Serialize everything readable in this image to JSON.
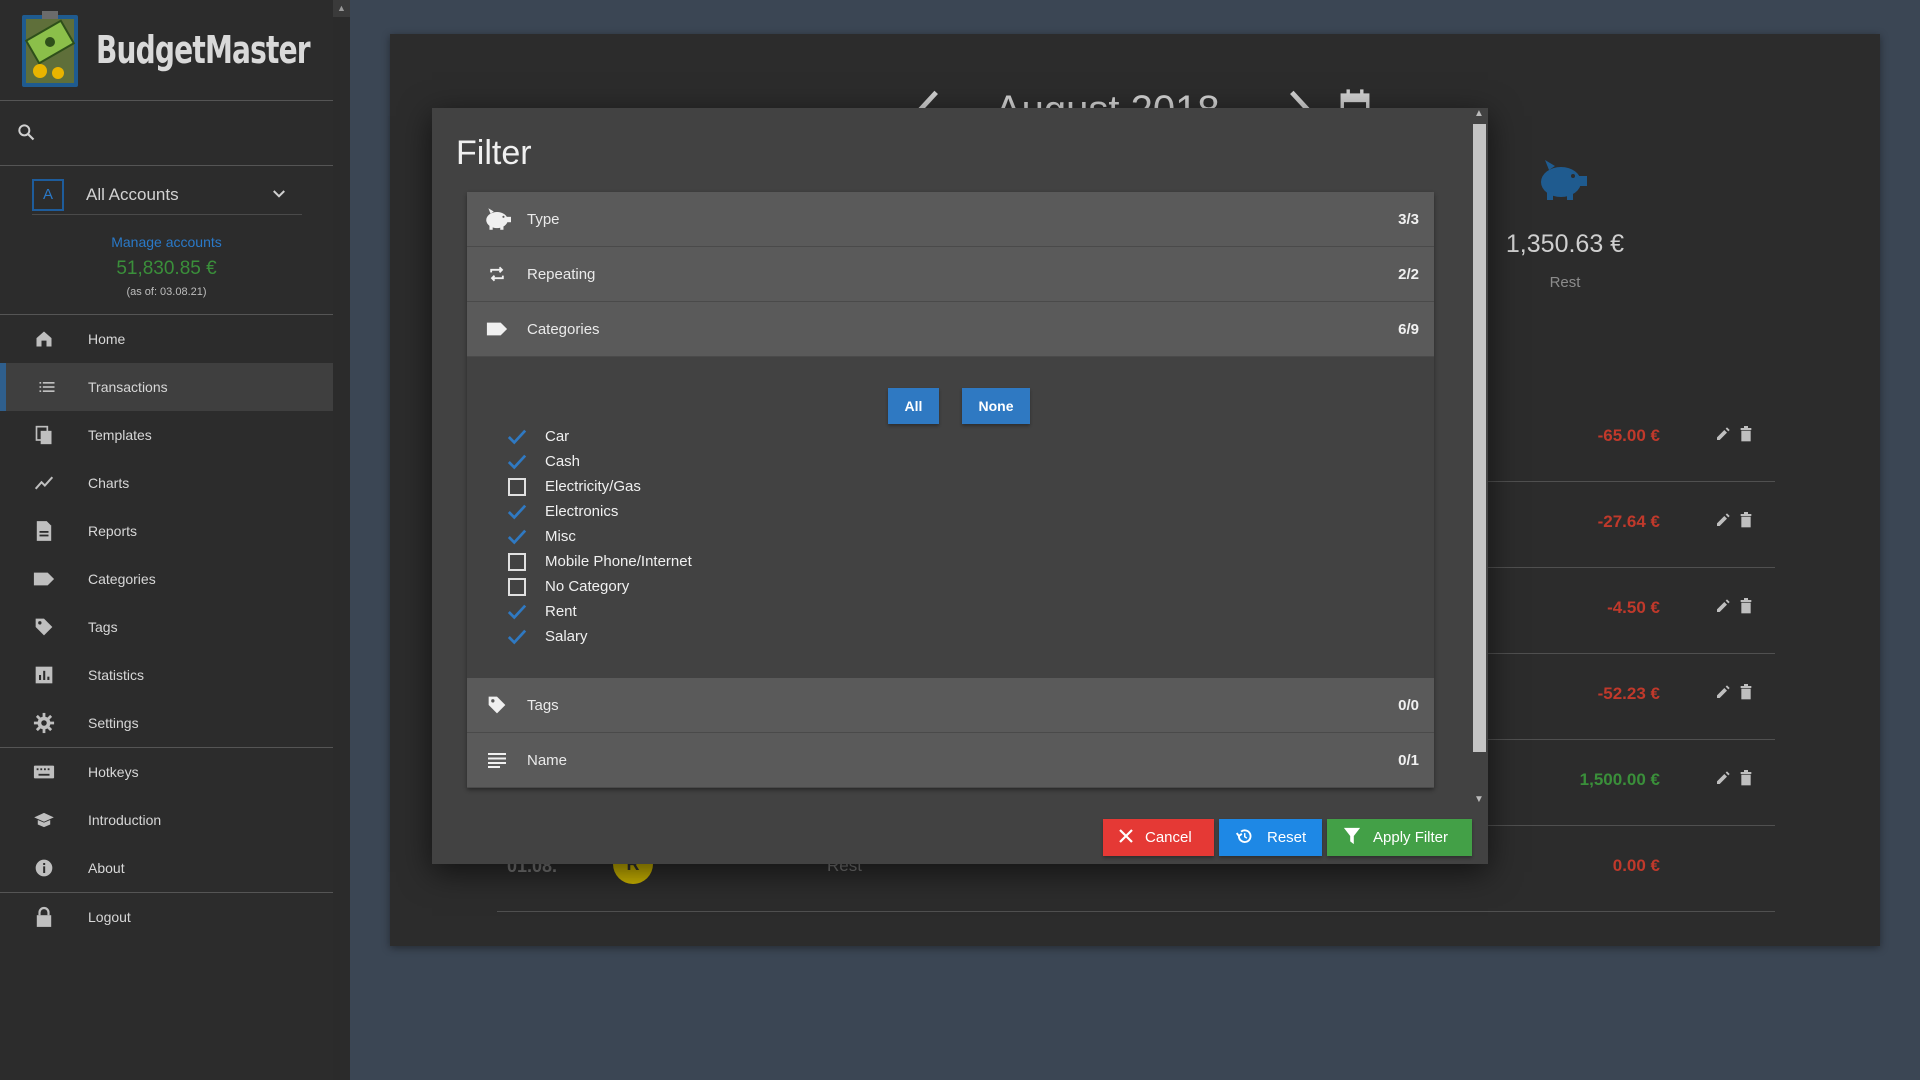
{
  "app": {
    "name": "BudgetMaster"
  },
  "sidebar": {
    "account": {
      "badge": "A",
      "name": "All Accounts"
    },
    "manage_label": "Manage accounts",
    "balance": "51,830.85 €",
    "as_of": "(as of: 03.08.21)",
    "items": [
      {
        "label": "Home",
        "icon": "home-icon"
      },
      {
        "label": "Transactions",
        "icon": "list-icon",
        "active": true
      },
      {
        "label": "Templates",
        "icon": "file-copy-icon"
      },
      {
        "label": "Charts",
        "icon": "show-chart-icon"
      },
      {
        "label": "Reports",
        "icon": "description-icon"
      },
      {
        "label": "Categories",
        "icon": "label-icon"
      },
      {
        "label": "Tags",
        "icon": "local-offer-icon"
      },
      {
        "label": "Statistics",
        "icon": "assessment-icon"
      },
      {
        "label": "Settings",
        "icon": "settings-icon"
      },
      {
        "label": "Hotkeys",
        "icon": "keyboard-icon"
      },
      {
        "label": "Introduction",
        "icon": "school-icon"
      },
      {
        "label": "About",
        "icon": "info-icon"
      },
      {
        "label": "Logout",
        "icon": "lock-icon"
      }
    ]
  },
  "main": {
    "month": "August 2018",
    "rest": {
      "amount": "1,350.63 €",
      "label": "Rest"
    },
    "transactions": [
      {
        "amount": "-65.00 €",
        "color": "#c0392b"
      },
      {
        "amount": "-27.64 €",
        "color": "#c0392b"
      },
      {
        "amount": "-4.50 €",
        "color": "#c0392b"
      },
      {
        "amount": "-52.23 €",
        "color": "#c0392b"
      },
      {
        "amount": "1,500.00 €",
        "color": "#3a8f3a"
      },
      {
        "date": "01.08.",
        "badge": "R",
        "description": "Rest",
        "amount": "0.00 €",
        "color": "#c0392b"
      }
    ]
  },
  "filter": {
    "title": "Filter",
    "sections": {
      "type": {
        "label": "Type",
        "count": "3/3"
      },
      "repeating": {
        "label": "Repeating",
        "count": "2/2"
      },
      "categories": {
        "label": "Categories",
        "count": "6/9"
      },
      "tags": {
        "label": "Tags",
        "count": "0/0"
      },
      "name": {
        "label": "Name",
        "count": "0/1"
      }
    },
    "all_label": "All",
    "none_label": "None",
    "categories": [
      {
        "label": "Car",
        "checked": true
      },
      {
        "label": "Cash",
        "checked": true
      },
      {
        "label": "Electricity/Gas",
        "checked": false
      },
      {
        "label": "Electronics",
        "checked": true
      },
      {
        "label": "Misc",
        "checked": true
      },
      {
        "label": "Mobile Phone/Internet",
        "checked": false
      },
      {
        "label": "No Category",
        "checked": false
      },
      {
        "label": "Rent",
        "checked": true
      },
      {
        "label": "Salary",
        "checked": true
      }
    ],
    "buttons": {
      "cancel": "Cancel",
      "reset": "Reset",
      "apply": "Apply Filter"
    }
  },
  "colors": {
    "accent": "#2f79c2",
    "cancel": "#e53935",
    "apply": "#43a047",
    "reset": "#1e88e5"
  }
}
